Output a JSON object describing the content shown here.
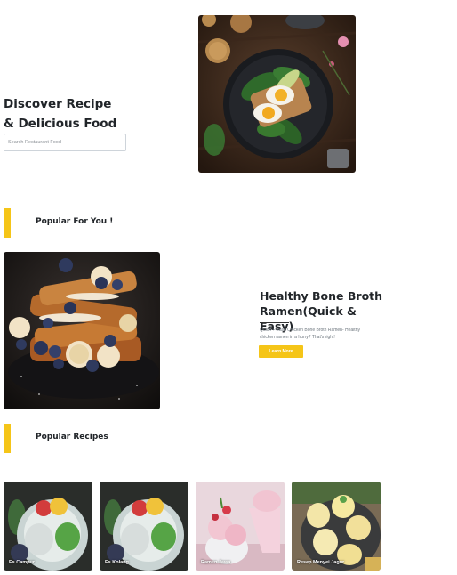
{
  "hero": {
    "title_line1": "Discover Recipe",
    "title_line2": "& Delicious Food",
    "search_placeholder": "Search Restaurant Food"
  },
  "sections": {
    "popular_for_you": "Popular For You !",
    "popular_recipes": "Popular Recipes"
  },
  "featured": {
    "title": "Healthy Bone Broth Ramen(Quick & Easy)",
    "description": "Quick + Easy Chicken Bone Broth Ramen- Healthy chicken ramen in a hurry? That's right!",
    "button_label": "Learn More"
  },
  "recipes": [
    {
      "label": "Es Campur"
    },
    {
      "label": "Es Kolang"
    },
    {
      "label": "Ramen Jawa"
    },
    {
      "label": "Resep Menyei Jagur"
    }
  ],
  "colors": {
    "accent": "#f5c518",
    "text": "#212529",
    "muted": "#6c757d"
  }
}
